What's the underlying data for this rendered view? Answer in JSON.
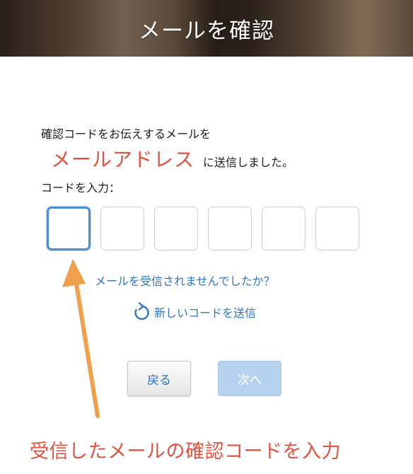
{
  "header": {
    "title": "メールを確認"
  },
  "instructions": {
    "line1": "確認コードをお伝えするメールを",
    "email_placeholder": "メールアドレス",
    "line2_suffix": "に送信しました。",
    "code_label": "コードを入力："
  },
  "code_inputs": [
    "",
    "",
    "",
    "",
    "",
    ""
  ],
  "links": {
    "not_received": "メールを受信されませんでしたか？",
    "resend": "新しいコードを送信"
  },
  "buttons": {
    "back": "戻る",
    "next": "次へ"
  },
  "annotation": {
    "caption": "受信したメールの確認コードを入力",
    "color": "#e0533f",
    "arrow_color": "#f0a04b"
  },
  "colors": {
    "accent": "#2f76c1",
    "active_border": "#4d8fd1",
    "disabled_button": "#b7d2ef"
  },
  "icons": {
    "resend": "refresh-icon"
  }
}
